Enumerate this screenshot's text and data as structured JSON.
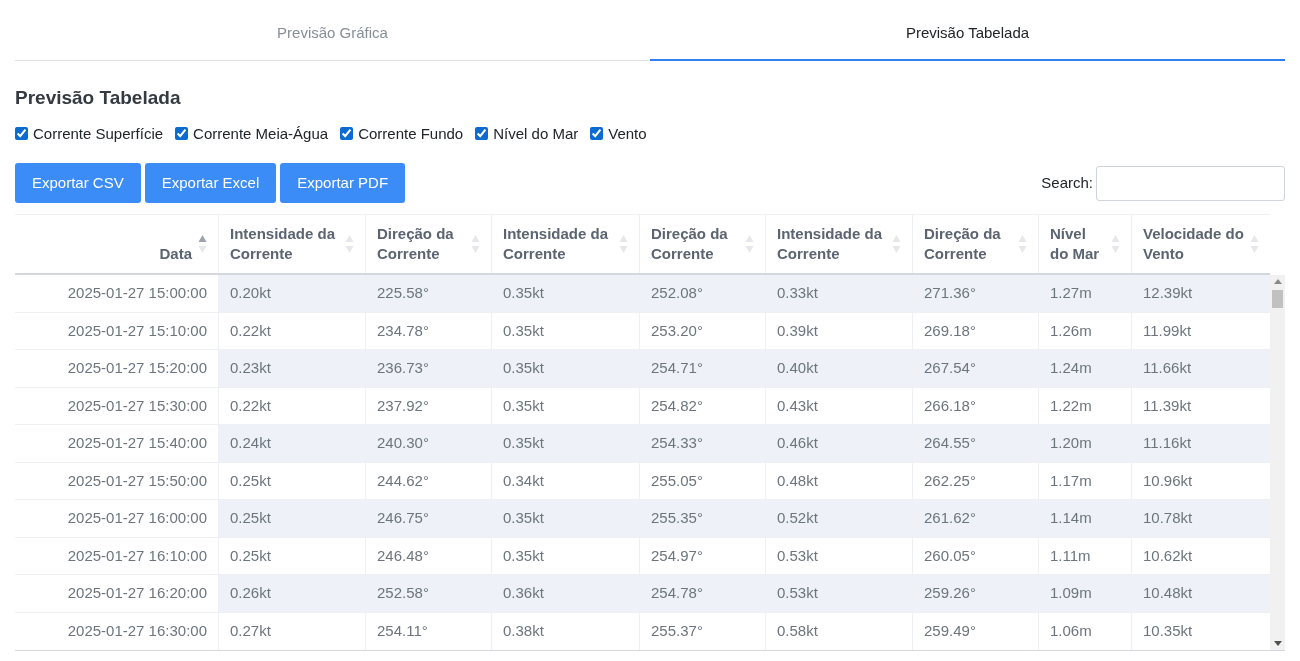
{
  "tabs": [
    {
      "label": "Previsão Gráfica",
      "selected": false
    },
    {
      "label": "Previsão Tabelada",
      "selected": true
    }
  ],
  "heading": "Previsão Tabelada",
  "filters": [
    {
      "label": "Corrente Superfície",
      "checked": true
    },
    {
      "label": "Corrente Meia-Água",
      "checked": true
    },
    {
      "label": "Corrente Fundo",
      "checked": true
    },
    {
      "label": "Nível do Mar",
      "checked": true
    },
    {
      "label": "Vento",
      "checked": true
    }
  ],
  "buttons": [
    "Exportar CSV",
    "Exportar Excel",
    "Exportar PDF"
  ],
  "search": {
    "label": "Search:"
  },
  "table": {
    "columns": [
      {
        "label": "Data",
        "sorted": true
      },
      {
        "label": "Intensidade da Corrente",
        "sorted": false
      },
      {
        "label": "Direção da Corrente",
        "sorted": false
      },
      {
        "label": "Intensidade da Corrente",
        "sorted": false
      },
      {
        "label": "Direção da Corrente",
        "sorted": false
      },
      {
        "label": "Intensidade da Corrente",
        "sorted": false
      },
      {
        "label": "Direção da Corrente",
        "sorted": false
      },
      {
        "label": "Nível do Mar",
        "sorted": false
      },
      {
        "label": "Velocidade do Vento",
        "sorted": false
      }
    ],
    "rows": [
      [
        "2025-01-27 15:00:00",
        "0.20kt",
        "225.58°",
        "0.35kt",
        "252.08°",
        "0.33kt",
        "271.36°",
        "1.27m",
        "12.39kt"
      ],
      [
        "2025-01-27 15:10:00",
        "0.22kt",
        "234.78°",
        "0.35kt",
        "253.20°",
        "0.39kt",
        "269.18°",
        "1.26m",
        "11.99kt"
      ],
      [
        "2025-01-27 15:20:00",
        "0.23kt",
        "236.73°",
        "0.35kt",
        "254.71°",
        "0.40kt",
        "267.54°",
        "1.24m",
        "11.66kt"
      ],
      [
        "2025-01-27 15:30:00",
        "0.22kt",
        "237.92°",
        "0.35kt",
        "254.82°",
        "0.43kt",
        "266.18°",
        "1.22m",
        "11.39kt"
      ],
      [
        "2025-01-27 15:40:00",
        "0.24kt",
        "240.30°",
        "0.35kt",
        "254.33°",
        "0.46kt",
        "264.55°",
        "1.20m",
        "11.16kt"
      ],
      [
        "2025-01-27 15:50:00",
        "0.25kt",
        "244.62°",
        "0.34kt",
        "255.05°",
        "0.48kt",
        "262.25°",
        "1.17m",
        "10.96kt"
      ],
      [
        "2025-01-27 16:00:00",
        "0.25kt",
        "246.75°",
        "0.35kt",
        "255.35°",
        "0.52kt",
        "261.62°",
        "1.14m",
        "10.78kt"
      ],
      [
        "2025-01-27 16:10:00",
        "0.25kt",
        "246.48°",
        "0.35kt",
        "254.97°",
        "0.53kt",
        "260.05°",
        "1.11m",
        "10.62kt"
      ],
      [
        "2025-01-27 16:20:00",
        "0.26kt",
        "252.58°",
        "0.36kt",
        "254.78°",
        "0.53kt",
        "259.26°",
        "1.09m",
        "10.48kt"
      ],
      [
        "2025-01-27 16:30:00",
        "0.27kt",
        "254.11°",
        "0.38kt",
        "255.37°",
        "0.58kt",
        "259.49°",
        "1.06m",
        "10.35kt"
      ]
    ]
  }
}
